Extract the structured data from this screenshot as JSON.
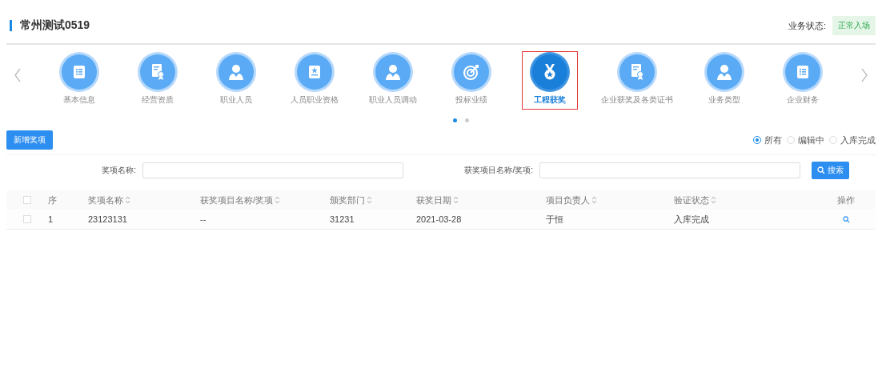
{
  "header": {
    "title": "常州测试0519",
    "status_label": "业务状态:",
    "status_value": "正常入场"
  },
  "nav": {
    "items": [
      {
        "label": "基本信息",
        "kind": "list",
        "selected": false
      },
      {
        "label": "经营资质",
        "kind": "certificate",
        "selected": false
      },
      {
        "label": "职业人员",
        "kind": "person",
        "selected": false
      },
      {
        "label": "人员职业资格",
        "kind": "badge",
        "selected": false
      },
      {
        "label": "职业人员调动",
        "kind": "person",
        "selected": false
      },
      {
        "label": "投标业绩",
        "kind": "target",
        "selected": false
      },
      {
        "label": "工程获奖",
        "kind": "medal",
        "selected": true
      },
      {
        "label": "企业获奖及各类证书",
        "kind": "certificate",
        "selected": false
      },
      {
        "label": "业务类型",
        "kind": "person",
        "selected": false
      },
      {
        "label": "企业财务",
        "kind": "list",
        "selected": false
      }
    ],
    "pages": [
      {
        "selected": true
      },
      {
        "selected": false
      }
    ]
  },
  "add_button": "新增奖项",
  "filters": [
    {
      "label": "所有",
      "selected": true
    },
    {
      "label": "编辑中",
      "selected": false
    },
    {
      "label": "入库完成",
      "selected": false
    }
  ],
  "search": {
    "fields": [
      {
        "label": "奖项名称:"
      },
      {
        "label": "获奖项目名称/奖项:"
      }
    ],
    "button": "搜索"
  },
  "table": {
    "columns": [
      {
        "label": "序",
        "sortable": false
      },
      {
        "label": "奖项名称",
        "sortable": true
      },
      {
        "label": "获奖项目名称/奖项",
        "sortable": true
      },
      {
        "label": "颁奖部门",
        "sortable": true
      },
      {
        "label": "获奖日期",
        "sortable": true
      },
      {
        "label": "项目负责人",
        "sortable": true
      },
      {
        "label": "验证状态",
        "sortable": true
      },
      {
        "label": "操作",
        "sortable": false
      }
    ],
    "header_checked": false,
    "rows": [
      {
        "checked": false,
        "cells": [
          "1",
          "23123131",
          "--",
          "31231",
          "2021-03-28",
          "于恒",
          "入库完成"
        ]
      }
    ]
  }
}
